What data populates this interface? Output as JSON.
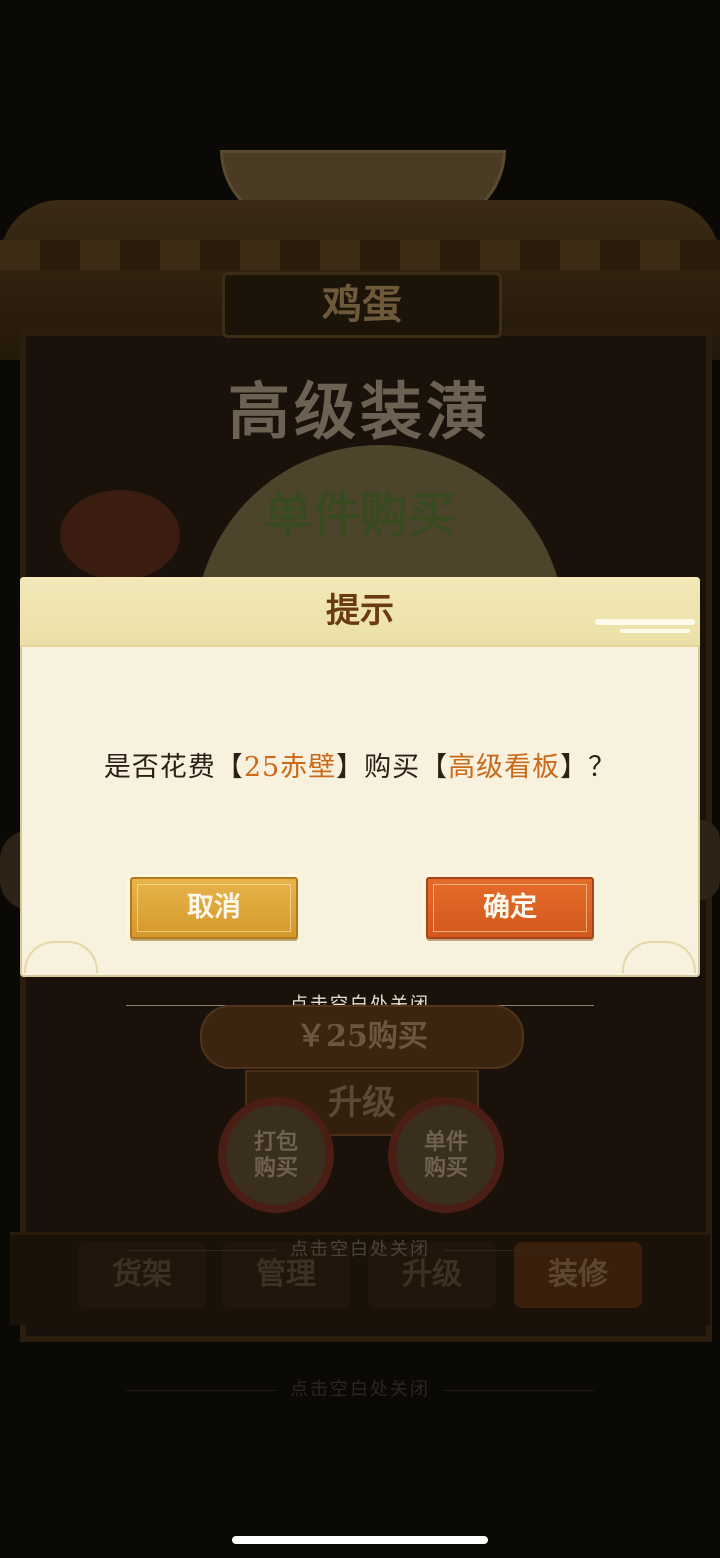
{
  "background": {
    "shop_name": "鸡蛋",
    "banner_title": "高级装潢",
    "banner_subtitle": "单件购买",
    "price_button": "￥25购买",
    "upgrade_button": "升级",
    "pack_buy_button": [
      "打包",
      "购买"
    ],
    "single_buy_button": [
      "单件",
      "购买"
    ],
    "tabs": [
      "货架",
      "管理",
      "升级",
      "装修"
    ],
    "close_hints": [
      "点击空白处关闭",
      "点击空白处关闭",
      "点击空白处关闭"
    ]
  },
  "dialog": {
    "title": "提示",
    "message": {
      "prefix": "是否花费【",
      "cost": "25赤壁",
      "middle": "】购买【",
      "item": "高级看板",
      "suffix": "】？"
    },
    "cancel_label": "取消",
    "confirm_label": "确定"
  },
  "colors": {
    "dialog_bg": "#f7f1de",
    "header_bg": "#f2e8b8",
    "title": "#6a3a14",
    "highlight": "#c96a1c",
    "cancel_button": "#e0a93c",
    "confirm_button": "#e0632a"
  }
}
